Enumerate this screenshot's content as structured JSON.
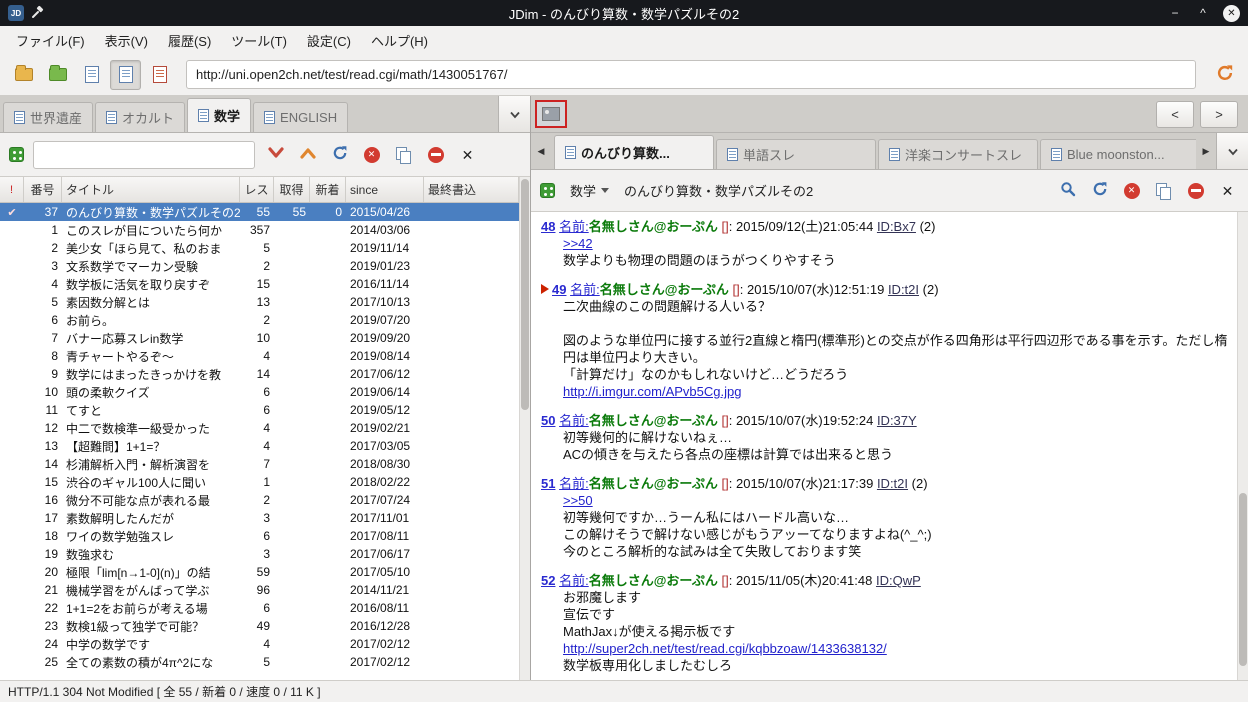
{
  "titlebar": {
    "title": "JDim - のんびり算数・数学パズルその2"
  },
  "menubar": {
    "items": [
      "ファイル(F)",
      "表示(V)",
      "履歴(S)",
      "ツール(T)",
      "設定(C)",
      "ヘルプ(H)"
    ]
  },
  "toolbar": {
    "url": "http://uni.open2ch.net/test/read.cgi/math/1430051767/"
  },
  "icons": {
    "minimize": "−",
    "maximize": "^",
    "close_window": "✕",
    "close": "✕",
    "app_logo": "JD",
    "stop": "✕"
  },
  "board_pane": {
    "tabs": [
      {
        "label": "世界遺産",
        "active": false
      },
      {
        "label": "オカルト",
        "active": false
      },
      {
        "label": "数学",
        "active": true
      },
      {
        "label": "ENGLISH",
        "active": false
      }
    ],
    "search_value": "",
    "headers": [
      "!",
      "番号",
      "タイトル",
      "レス",
      "取得",
      "新着",
      "since",
      "最終書込"
    ],
    "rows": [
      {
        "mark": "✔",
        "num": "37",
        "title": "のんびり算数・数学パズルその2",
        "res": "55",
        "got": "55",
        "new": "0",
        "since": "2015/04/26",
        "last": "",
        "selected": true
      },
      {
        "mark": "",
        "num": "1",
        "title": "このスレが目についたら何か",
        "res": "357",
        "got": "",
        "new": "",
        "since": "2014/03/06",
        "last": ""
      },
      {
        "mark": "",
        "num": "2",
        "title": "美少女「ほら見て、私のおま",
        "res": "5",
        "got": "",
        "new": "",
        "since": "2019/11/14",
        "last": ""
      },
      {
        "mark": "",
        "num": "3",
        "title": "文系数学でマーカン受験",
        "res": "2",
        "got": "",
        "new": "",
        "since": "2019/01/23",
        "last": ""
      },
      {
        "mark": "",
        "num": "4",
        "title": "数学板に活気を取り戻すぞ",
        "res": "15",
        "got": "",
        "new": "",
        "since": "2016/11/14",
        "last": ""
      },
      {
        "mark": "",
        "num": "5",
        "title": "素因数分解とは",
        "res": "13",
        "got": "",
        "new": "",
        "since": "2017/10/13",
        "last": ""
      },
      {
        "mark": "",
        "num": "6",
        "title": "お前ら。",
        "res": "2",
        "got": "",
        "new": "",
        "since": "2019/07/20",
        "last": ""
      },
      {
        "mark": "",
        "num": "7",
        "title": "バナー応募スレin数学",
        "res": "10",
        "got": "",
        "new": "",
        "since": "2019/09/20",
        "last": ""
      },
      {
        "mark": "",
        "num": "8",
        "title": "青チャートやるぞ〜",
        "res": "4",
        "got": "",
        "new": "",
        "since": "2019/08/14",
        "last": ""
      },
      {
        "mark": "",
        "num": "9",
        "title": "数学にはまったきっかけを教",
        "res": "14",
        "got": "",
        "new": "",
        "since": "2017/06/12",
        "last": ""
      },
      {
        "mark": "",
        "num": "10",
        "title": "頭の柔軟クイズ",
        "res": "6",
        "got": "",
        "new": "",
        "since": "2019/06/14",
        "last": ""
      },
      {
        "mark": "",
        "num": "11",
        "title": "てすと",
        "res": "6",
        "got": "",
        "new": "",
        "since": "2019/05/12",
        "last": ""
      },
      {
        "mark": "",
        "num": "12",
        "title": "中二で数検準一級受かった",
        "res": "4",
        "got": "",
        "new": "",
        "since": "2019/02/21",
        "last": ""
      },
      {
        "mark": "",
        "num": "13",
        "title": "【超難問】1+1=？",
        "res": "4",
        "got": "",
        "new": "",
        "since": "2017/03/05",
        "last": ""
      },
      {
        "mark": "",
        "num": "14",
        "title": "杉浦解析入門・解析演習を",
        "res": "7",
        "got": "",
        "new": "",
        "since": "2018/08/30",
        "last": ""
      },
      {
        "mark": "",
        "num": "15",
        "title": "渋谷のギャル100人に聞い",
        "res": "1",
        "got": "",
        "new": "",
        "since": "2018/02/22",
        "last": ""
      },
      {
        "mark": "",
        "num": "16",
        "title": "微分不可能な点が表れる最",
        "res": "2",
        "got": "",
        "new": "",
        "since": "2017/07/24",
        "last": ""
      },
      {
        "mark": "",
        "num": "17",
        "title": "素数解明したんだが",
        "res": "3",
        "got": "",
        "new": "",
        "since": "2017/11/01",
        "last": ""
      },
      {
        "mark": "",
        "num": "18",
        "title": "ワイの数学勉強スレ",
        "res": "6",
        "got": "",
        "new": "",
        "since": "2017/08/11",
        "last": ""
      },
      {
        "mark": "",
        "num": "19",
        "title": "数強求む",
        "res": "3",
        "got": "",
        "new": "",
        "since": "2017/06/17",
        "last": ""
      },
      {
        "mark": "",
        "num": "20",
        "title": "極限「lim[n→1-0](n)」の結",
        "res": "59",
        "got": "",
        "new": "",
        "since": "2017/05/10",
        "last": ""
      },
      {
        "mark": "",
        "num": "21",
        "title": "機械学習をがんばって学ぶ",
        "res": "96",
        "got": "",
        "new": "",
        "since": "2014/11/21",
        "last": ""
      },
      {
        "mark": "",
        "num": "22",
        "title": "1+1=2をお前らが考える場",
        "res": "6",
        "got": "",
        "new": "",
        "since": "2016/08/11",
        "last": ""
      },
      {
        "mark": "",
        "num": "23",
        "title": "数検1級って独学で可能？",
        "res": "49",
        "got": "",
        "new": "",
        "since": "2016/12/28",
        "last": ""
      },
      {
        "mark": "",
        "num": "24",
        "title": "中学の数学です",
        "res": "4",
        "got": "",
        "new": "",
        "since": "2017/02/12",
        "last": ""
      },
      {
        "mark": "",
        "num": "25",
        "title": "全ての素数の積が4π^2にな",
        "res": "5",
        "got": "",
        "new": "",
        "since": "2017/02/12",
        "last": ""
      }
    ]
  },
  "image_bar": {
    "prev": "<",
    "next": ">"
  },
  "thread_pane": {
    "nav_left": "◀",
    "nav_right": "▶",
    "tabs": [
      {
        "label": "のんびり算数...",
        "active": true
      },
      {
        "label": "単語スレ",
        "active": false
      },
      {
        "label": "洋楽コンサートスレ",
        "active": false
      },
      {
        "label": "Blue moonston...",
        "active": false
      }
    ],
    "board_select": "数学",
    "title": "のんびり算数・数学パズルその2",
    "post_meta": {
      "name_label": "名前",
      "label_sep": ":",
      "name": "名無しさん@おーぷん",
      "mail": "[]",
      "mail_sep": ":"
    },
    "posts": [
      {
        "num": "48",
        "marked": false,
        "date": "2015/09/12(土)21:05:44",
        "id": "ID:Bx7",
        "count": "(2)",
        "lines": [
          {
            "type": "anchor",
            "text": ">>42"
          },
          {
            "type": "text",
            "text": "数学よりも物理の問題のほうがつくりやすそう"
          }
        ]
      },
      {
        "num": "49",
        "marked": true,
        "date": "2015/10/07(水)12:51:19",
        "id": "ID:t2I",
        "count": "(2)",
        "lines": [
          {
            "type": "text",
            "text": "二次曲線のこの問題解ける人いる？"
          },
          {
            "type": "text",
            "text": ""
          },
          {
            "type": "text",
            "text": "図のような単位円に接する並行2直線と楕円(標準形)との交点が作る四角形は平行四辺形である事を示す。ただし楕円は単位円より大きい。"
          },
          {
            "type": "text",
            "text": "「計算だけ」なのかもしれないけど…どうだろう"
          },
          {
            "type": "link",
            "text": "http://i.imgur.com/APvb5Cg.jpg"
          }
        ]
      },
      {
        "num": "50",
        "marked": false,
        "date": "2015/10/07(水)19:52:24",
        "id": "ID:37Y",
        "count": "",
        "lines": [
          {
            "type": "text",
            "text": "初等幾何的に解けないねぇ…"
          },
          {
            "type": "text",
            "text": "ACの傾きを与えたら各点の座標は計算では出来ると思う"
          }
        ]
      },
      {
        "num": "51",
        "marked": false,
        "date": "2015/10/07(水)21:17:39",
        "id": "ID:t2I",
        "count": "(2)",
        "lines": [
          {
            "type": "anchor",
            "text": ">>50"
          },
          {
            "type": "text",
            "text": "初等幾何ですか…うーん私にはハードル高いな…"
          },
          {
            "type": "text",
            "text": "この解けそうで解けない感じがもうアッーてなりますよね(^_^;)"
          },
          {
            "type": "text",
            "text": "今のところ解析的な試みは全て失敗しております笑"
          }
        ]
      },
      {
        "num": "52",
        "marked": false,
        "date": "2015/11/05(木)20:41:48",
        "id": "ID:QwP",
        "count": "",
        "lines": [
          {
            "type": "text",
            "text": "お邪魔します"
          },
          {
            "type": "text",
            "text": "宣伝です"
          },
          {
            "type": "text",
            "text": "MathJax↓が使える掲示板です"
          },
          {
            "type": "link",
            "text": "http://super2ch.net/test/read.cgi/kqbbzoaw/1433638132/"
          },
          {
            "type": "text",
            "text": "数学板専用化しましたむしろ"
          }
        ]
      }
    ]
  },
  "statusbar": {
    "text": "HTTP/1.1 304 Not Modified [ 全 55 / 新着 0 / 速度 0 / 11 K ]"
  }
}
